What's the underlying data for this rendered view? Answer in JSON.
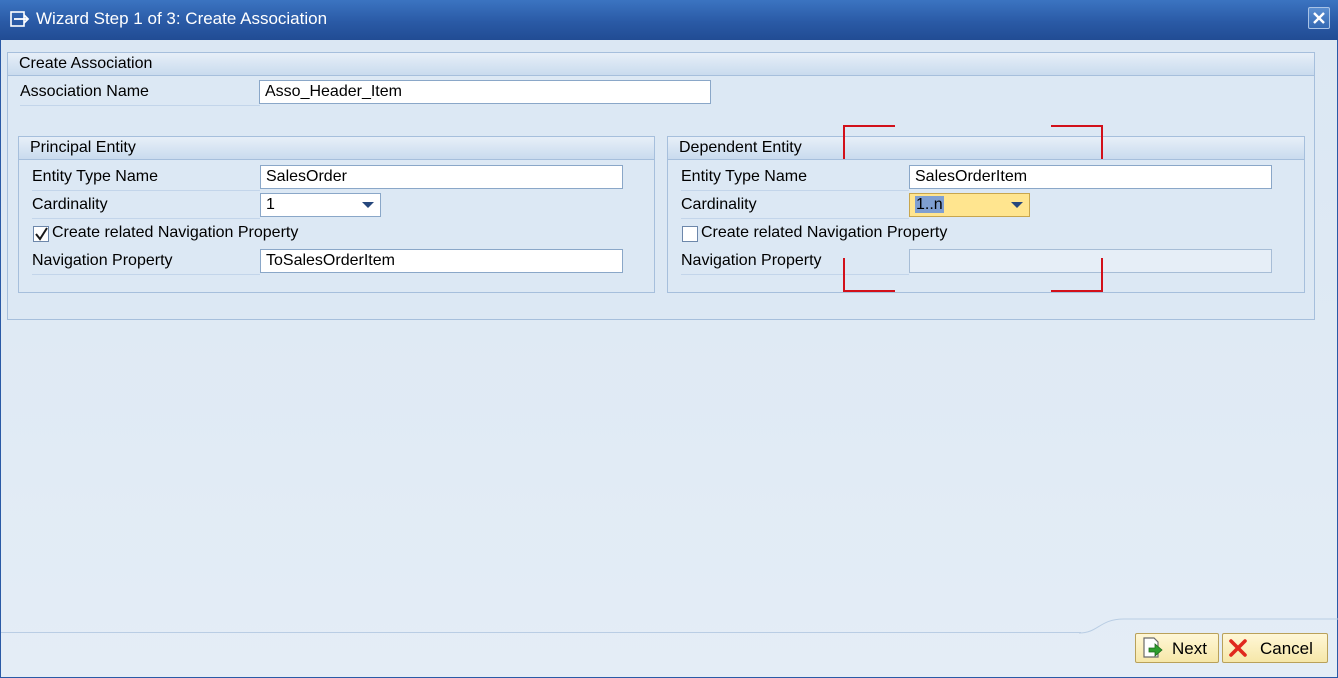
{
  "window": {
    "title": "Wizard Step 1 of 3: Create Association",
    "close_icon": "close-icon"
  },
  "create_association": {
    "group_title": "Create Association",
    "name_label": "Association Name",
    "name_value": "Asso_Header_Item"
  },
  "principal": {
    "group_title": "Principal Entity",
    "entity_type_label": "Entity Type Name",
    "entity_type_value": "SalesOrder",
    "cardinality_label": "Cardinality",
    "cardinality_value": "1",
    "nav_checkbox_label": "Create related Navigation Property",
    "nav_checkbox_checked": true,
    "nav_property_label": "Navigation Property",
    "nav_property_value": "ToSalesOrderItem"
  },
  "dependent": {
    "group_title": "Dependent Entity",
    "entity_type_label": "Entity Type Name",
    "entity_type_value": "SalesOrderItem",
    "cardinality_label": "Cardinality",
    "cardinality_value": "1..n",
    "nav_checkbox_label": "Create related Navigation Property",
    "nav_checkbox_checked": false,
    "nav_property_label": "Navigation Property",
    "nav_property_value": ""
  },
  "footer": {
    "next_label": "Next",
    "cancel_label": "Cancel"
  },
  "colors": {
    "title_bar": "#2a5aa6",
    "focus_highlight": "#ffe58f",
    "annotation_red": "#d2101a",
    "button_bg": "#f6e7a9"
  }
}
